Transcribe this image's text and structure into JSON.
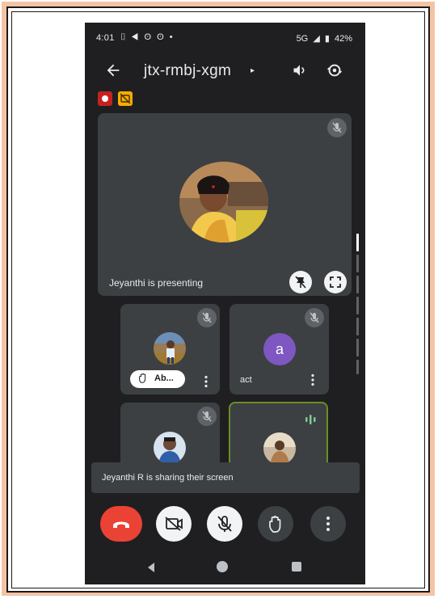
{
  "status_bar": {
    "time": "4:01",
    "left_icons": "⌷ ◀ ʘ ʘ •",
    "network": "5G",
    "battery": "42%"
  },
  "meeting": {
    "code": "jtx-rmbj-xgm",
    "chevron": "▸"
  },
  "presentation": {
    "label": "Jeyanthi is presenting"
  },
  "participants": [
    {
      "chip_name": "Ab...",
      "raised_hand": true,
      "mic_muted": true
    },
    {
      "name": "act",
      "initial": "a",
      "mic_muted": true,
      "avatar_color": "#7e57c2"
    },
    {
      "mic_muted": true
    },
    {
      "speaking": true,
      "speaking_color": "#81c995"
    }
  ],
  "snackbar": {
    "text": "Jeyanthi R is sharing their screen"
  },
  "controls": {
    "end_call_color": "#ea4335"
  },
  "icons": {
    "back": "arrow-left-icon",
    "speaker": "speaker-icon",
    "flip": "camera-flip-icon",
    "recording": "record-icon",
    "captions": "captions-off-icon",
    "mic_off": "mic-off-icon",
    "fullscreen": "fullscreen-icon",
    "end_call": "end-call-icon",
    "camera_off": "camera-off-icon",
    "raise_hand": "raise-hand-icon",
    "more": "more-vert-icon"
  }
}
